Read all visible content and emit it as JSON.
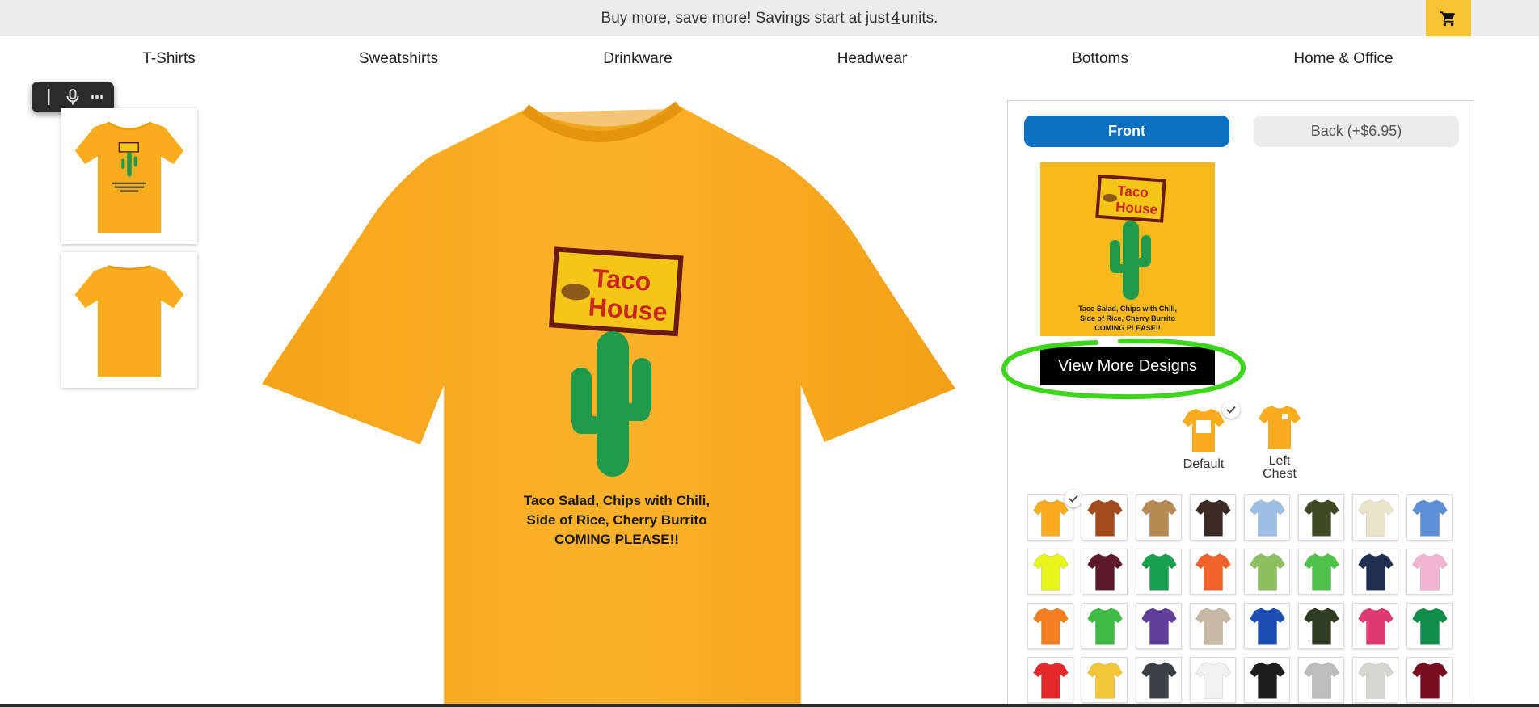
{
  "promo": {
    "text_before": "Buy more, save more! Savings start at just",
    "units": "4",
    "text_after": "units."
  },
  "cart": {
    "icon": "cart-icon"
  },
  "nav": {
    "items": [
      "T-Shirts",
      "Sweatshirts",
      "Drinkware",
      "Headwear",
      "Bottoms",
      "Home & Office"
    ]
  },
  "toolbar": {
    "icons": [
      "text-cursor-icon",
      "microphone-icon",
      "more-icon"
    ]
  },
  "product": {
    "shirt_color": "#f9ad1e",
    "design": {
      "sign_line1": "Taco",
      "sign_line2": "House",
      "caption_line1": "Taco Salad, Chips with Chili,",
      "caption_line2": "Side of Rice, Cherry Burrito",
      "caption_line3": "COMING PLEASE!!"
    }
  },
  "panel": {
    "front_label": "Front",
    "back_label": "Back (+$6.95)",
    "view_more_label": "View More Designs",
    "placements": [
      {
        "label": "Default",
        "selected": true
      },
      {
        "label": "Left Chest",
        "selected": false
      }
    ],
    "colors": [
      "#f9ad1e",
      "#a24a1c",
      "#b68a52",
      "#3a2a24",
      "#9dbfe3",
      "#3f4a24",
      "#ece3cb",
      "#5b8fd6",
      "#e6f51b",
      "#5a1a2c",
      "#17a04d",
      "#f0622a",
      "#8fbf5e",
      "#4fc24a",
      "#1f2f52",
      "#f2b5cf",
      "#f57f20",
      "#3dbb44",
      "#5e3e9a",
      "#c7b9a4",
      "#1c4fb5",
      "#2e3d22",
      "#e03a72",
      "#0e8e4a",
      "#e22a2e",
      "#f2c737",
      "#3b4045",
      "#f1f1f1",
      "#1d1d1d",
      "#bdbdbd",
      "#d7d7d2",
      "#7a0c22"
    ]
  }
}
